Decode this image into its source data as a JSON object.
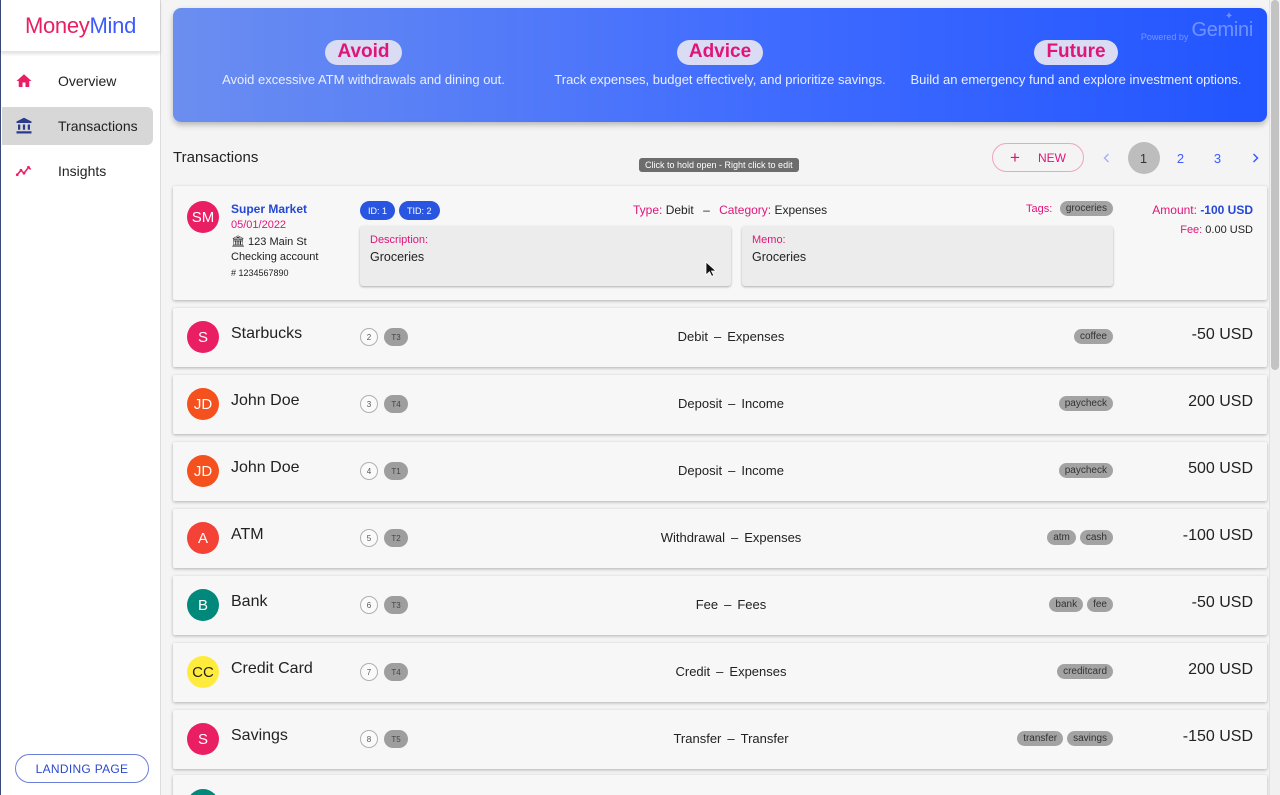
{
  "app": {
    "logo_part1": "Money",
    "logo_part2": "Mind"
  },
  "sidebar": {
    "items": [
      {
        "label": "Overview",
        "icon": "home-icon"
      },
      {
        "label": "Transactions",
        "icon": "bank-icon",
        "active": true
      },
      {
        "label": "Insights",
        "icon": "trending-icon"
      }
    ],
    "landing_button": "LANDING PAGE"
  },
  "banner": {
    "powered_by": "Powered by",
    "brand": "Gemini",
    "cards": [
      {
        "title": "Avoid",
        "text": "Avoid excessive ATM withdrawals and dining out."
      },
      {
        "title": "Advice",
        "text": "Track expenses, budget effectively, and prioritize savings."
      },
      {
        "title": "Future",
        "text": "Build an emergency fund and explore investment options."
      }
    ]
  },
  "transactions": {
    "title": "Transactions",
    "new_button": "NEW",
    "tooltip": "Click to hold open - Right click to edit",
    "pages": [
      "1",
      "2",
      "3"
    ],
    "current_page": "1",
    "expanded": {
      "initials": "SM",
      "store": "Super Market",
      "date": "05/01/2022",
      "address": "123 Main St",
      "account": "Checking account",
      "account_number": "# 1234567890",
      "id_chip": "ID: 1",
      "tid_chip": "TID: 2",
      "type_label": "Type:",
      "type": "Debit",
      "category_label": "Category:",
      "category": "Expenses",
      "tags_label": "Tags:",
      "tags": [
        "groceries"
      ],
      "description_label": "Description:",
      "description": "Groceries",
      "memo_label": "Memo:",
      "memo": "Groceries",
      "amount_label": "Amount:",
      "amount": "-100 USD",
      "fee_label": "Fee:",
      "fee": "0.00 USD"
    },
    "rows": [
      {
        "initials": "S",
        "name": "Starbucks",
        "id": "2",
        "tid": "T3",
        "type": "Debit",
        "category": "Expenses",
        "tags": [
          "coffee"
        ],
        "amount": "-50 USD",
        "color": "#e91e63"
      },
      {
        "initials": "JD",
        "name": "John Doe",
        "id": "3",
        "tid": "T4",
        "type": "Deposit",
        "category": "Income",
        "tags": [
          "paycheck"
        ],
        "amount": "200 USD",
        "color": "#f4511e"
      },
      {
        "initials": "JD",
        "name": "John Doe",
        "id": "4",
        "tid": "T1",
        "type": "Deposit",
        "category": "Income",
        "tags": [
          "paycheck"
        ],
        "amount": "500 USD",
        "color": "#f4511e"
      },
      {
        "initials": "A",
        "name": "ATM",
        "id": "5",
        "tid": "T2",
        "type": "Withdrawal",
        "category": "Expenses",
        "tags": [
          "atm",
          "cash"
        ],
        "amount": "-100 USD",
        "color": "#f44336"
      },
      {
        "initials": "B",
        "name": "Bank",
        "id": "6",
        "tid": "T3",
        "type": "Fee",
        "category": "Fees",
        "tags": [
          "bank",
          "fee"
        ],
        "amount": "-50 USD",
        "color": "#00897b"
      },
      {
        "initials": "CC",
        "name": "Credit Card",
        "id": "7",
        "tid": "T4",
        "type": "Credit",
        "category": "Expenses",
        "tags": [
          "creditcard"
        ],
        "amount": "200 USD",
        "color": "#ffeb3b"
      },
      {
        "initials": "S",
        "name": "Savings",
        "id": "8",
        "tid": "T5",
        "type": "Transfer",
        "category": "Transfer",
        "tags": [
          "transfer",
          "savings"
        ],
        "amount": "-150 USD",
        "color": "#e91e63"
      }
    ],
    "separator": "–"
  }
}
